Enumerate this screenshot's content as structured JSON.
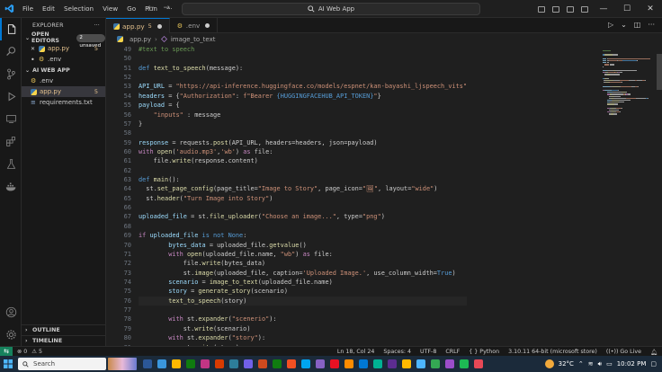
{
  "titlebar": {
    "menu": [
      "File",
      "Edit",
      "Selection",
      "View",
      "Go",
      "Run",
      "···"
    ],
    "search_text": "AI Web App",
    "back": "←",
    "forward": "→",
    "minimize": "—",
    "maximize": "☐",
    "close": "✕"
  },
  "sidebar": {
    "header": "EXPLORER",
    "open_editors_label": "OPEN EDITORS",
    "unsaved_badge": "2 unsaved",
    "open_editors": [
      {
        "name": "app.py",
        "count": "5"
      },
      {
        "name": ".env",
        "count": ""
      }
    ],
    "project_label": "AI WEB APP",
    "files": [
      {
        "name": ".env",
        "count": ""
      },
      {
        "name": "app.py",
        "count": "5"
      },
      {
        "name": "requirements.txt",
        "count": ""
      }
    ],
    "outline_label": "OUTLINE",
    "timeline_label": "TIMELINE"
  },
  "tabs": [
    {
      "name": "app.py",
      "count": "5"
    },
    {
      "name": ".env",
      "count": ""
    }
  ],
  "breadcrumb": {
    "file": "app.py",
    "symbol": "image_to_text"
  },
  "editor": {
    "line_numbers": [
      "49",
      "50",
      "51",
      "52",
      "53",
      "54",
      "55",
      "56",
      "57",
      "58",
      "59",
      "60",
      "61",
      "62",
      "63",
      "64",
      "65",
      "66",
      "67",
      "68",
      "69",
      "70",
      "71",
      "72",
      "73",
      "74",
      "75",
      "76",
      "77",
      "78",
      "79",
      "80",
      "81"
    ],
    "current_line_index": 27
  },
  "code_lines": [
    [
      [
        "#text to speech",
        "#6a9955"
      ]
    ],
    [],
    [
      [
        "def ",
        "#569cd6"
      ],
      [
        "text_to_speech",
        "#dcdcaa"
      ],
      [
        "(message):",
        "#cccccc"
      ]
    ],
    [],
    [
      [
        "API_URL",
        "#9cdcfe"
      ],
      [
        " = ",
        "#cccccc"
      ],
      [
        "\"https://api-inference.huggingface.co/models/espnet/kan-bayashi_ljspeech_vits\"",
        "#ce9178"
      ]
    ],
    [
      [
        "headers",
        "#9cdcfe"
      ],
      [
        " = {",
        "#cccccc"
      ],
      [
        "\"Authorization\"",
        "#ce9178"
      ],
      [
        ": ",
        "#cccccc"
      ],
      [
        "f\"Bearer ",
        "#ce9178"
      ],
      [
        "{HUGGINGFACEHUB_API_TOKEN}",
        "#569cd6"
      ],
      [
        "\"",
        "#ce9178"
      ],
      [
        "}",
        "#cccccc"
      ]
    ],
    [
      [
        "payload",
        "#9cdcfe"
      ],
      [
        " = {",
        "#cccccc"
      ]
    ],
    [
      [
        "    ",
        "#cccccc"
      ],
      [
        "\"inputs\"",
        "#ce9178"
      ],
      [
        " : message",
        "#cccccc"
      ]
    ],
    [
      [
        "}",
        "#cccccc"
      ]
    ],
    [],
    [
      [
        "response",
        "#9cdcfe"
      ],
      [
        " = requests.",
        "#cccccc"
      ],
      [
        "post",
        "#dcdcaa"
      ],
      [
        "(API_URL, headers=headers, json=payload)",
        "#cccccc"
      ]
    ],
    [
      [
        "with ",
        "#c586c0"
      ],
      [
        "open",
        "#dcdcaa"
      ],
      [
        "(",
        "#cccccc"
      ],
      [
        "'audio.mp3'",
        "#ce9178"
      ],
      [
        ",",
        "#cccccc"
      ],
      [
        "'wb'",
        "#ce9178"
      ],
      [
        ") ",
        "#cccccc"
      ],
      [
        "as ",
        "#c586c0"
      ],
      [
        "file:",
        "#cccccc"
      ]
    ],
    [
      [
        "    file.",
        "#cccccc"
      ],
      [
        "write",
        "#dcdcaa"
      ],
      [
        "(response.content)",
        "#cccccc"
      ]
    ],
    [],
    [
      [
        "def ",
        "#569cd6"
      ],
      [
        "main",
        "#dcdcaa"
      ],
      [
        "():",
        "#cccccc"
      ]
    ],
    [
      [
        "  st.",
        "#cccccc"
      ],
      [
        "set_page_config",
        "#dcdcaa"
      ],
      [
        "(page_title=",
        "#cccccc"
      ],
      [
        "\"Image to Story\"",
        "#ce9178"
      ],
      [
        ", page_icon=",
        "#cccccc"
      ],
      [
        "\"🖼\"",
        "#ce9178"
      ],
      [
        ", layout=",
        "#cccccc"
      ],
      [
        "\"wide\"",
        "#ce9178"
      ],
      [
        ")",
        "#cccccc"
      ]
    ],
    [
      [
        "  st.",
        "#cccccc"
      ],
      [
        "header",
        "#dcdcaa"
      ],
      [
        "(",
        "#cccccc"
      ],
      [
        "\"Turn Image into Story\"",
        "#ce9178"
      ],
      [
        ")",
        "#cccccc"
      ]
    ],
    [],
    [
      [
        "uploaded_file",
        "#9cdcfe"
      ],
      [
        " = st.",
        "#cccccc"
      ],
      [
        "file_uploader",
        "#dcdcaa"
      ],
      [
        "(",
        "#cccccc"
      ],
      [
        "\"Choose an image...\"",
        "#ce9178"
      ],
      [
        ", type=",
        "#cccccc"
      ],
      [
        "\"png\"",
        "#ce9178"
      ],
      [
        ")",
        "#cccccc"
      ]
    ],
    [],
    [
      [
        "if ",
        "#c586c0"
      ],
      [
        "uploaded_file ",
        "#9cdcfe"
      ],
      [
        "is not ",
        "#569cd6"
      ],
      [
        "None",
        "#569cd6"
      ],
      [
        ":",
        "#cccccc"
      ]
    ],
    [
      [
        "        bytes_data",
        "#9cdcfe"
      ],
      [
        " = uploaded_file.",
        "#cccccc"
      ],
      [
        "getvalue",
        "#dcdcaa"
      ],
      [
        "()",
        "#cccccc"
      ]
    ],
    [
      [
        "        with ",
        "#c586c0"
      ],
      [
        "open",
        "#dcdcaa"
      ],
      [
        "(uploaded_file.name, ",
        "#cccccc"
      ],
      [
        "\"wb\"",
        "#ce9178"
      ],
      [
        ") ",
        "#cccccc"
      ],
      [
        "as ",
        "#c586c0"
      ],
      [
        "file:",
        "#cccccc"
      ]
    ],
    [
      [
        "            file.",
        "#cccccc"
      ],
      [
        "write",
        "#dcdcaa"
      ],
      [
        "(bytes_data)",
        "#cccccc"
      ]
    ],
    [
      [
        "            st.",
        "#cccccc"
      ],
      [
        "image",
        "#dcdcaa"
      ],
      [
        "(uploaded_file, caption=",
        "#cccccc"
      ],
      [
        "'Uploaded Image.'",
        "#ce9178"
      ],
      [
        ", use_column_width=",
        "#cccccc"
      ],
      [
        "True",
        "#569cd6"
      ],
      [
        ")",
        "#cccccc"
      ]
    ],
    [
      [
        "        scenario",
        "#9cdcfe"
      ],
      [
        " = ",
        "#cccccc"
      ],
      [
        "image_to_text",
        "#dcdcaa"
      ],
      [
        "(uploaded_file.name)",
        "#cccccc"
      ]
    ],
    [
      [
        "        story",
        "#9cdcfe"
      ],
      [
        " = ",
        "#cccccc"
      ],
      [
        "generate_story",
        "#dcdcaa"
      ],
      [
        "(scenario)",
        "#cccccc"
      ]
    ],
    [
      [
        "        ",
        "#cccccc"
      ],
      [
        "text_to_speech",
        "#dcdcaa"
      ],
      [
        "(story)",
        "#cccccc"
      ]
    ],
    [],
    [
      [
        "        with ",
        "#c586c0"
      ],
      [
        "st.",
        "#cccccc"
      ],
      [
        "expander",
        "#dcdcaa"
      ],
      [
        "(",
        "#cccccc"
      ],
      [
        "\"scenerio\"",
        "#ce9178"
      ],
      [
        "):",
        "#cccccc"
      ]
    ],
    [
      [
        "            st.",
        "#cccccc"
      ],
      [
        "write",
        "#dcdcaa"
      ],
      [
        "(scenario)",
        "#cccccc"
      ]
    ],
    [
      [
        "        with ",
        "#c586c0"
      ],
      [
        "st.",
        "#cccccc"
      ],
      [
        "expander",
        "#dcdcaa"
      ],
      [
        "(",
        "#cccccc"
      ],
      [
        "\"story\"",
        "#ce9178"
      ],
      [
        "):",
        "#cccccc"
      ]
    ],
    [
      [
        "            st.",
        "#cccccc"
      ],
      [
        "write",
        "#dcdcaa"
      ],
      [
        "(story)",
        "#cccccc"
      ]
    ]
  ],
  "statusbar": {
    "errors": "⊗ 0",
    "warnings": "⚠ 5",
    "position": "Ln 18, Col 24",
    "spaces": "Spaces: 4",
    "encoding": "UTF-8",
    "eol": "CRLF",
    "language": "Python",
    "interpreter": "3.10.11 64-bit (microsoft store)",
    "golive": "Go Live"
  },
  "taskbar": {
    "search_placeholder": "Search",
    "temperature": "32°C",
    "time": "10:02 PM",
    "app_colors": [
      "#2b5797",
      "#3a96dd",
      "#ffb900",
      "#0f7b0f",
      "#c13584",
      "#d83b01",
      "#2d7d9a",
      "#7160e8",
      "#cf4a1f",
      "#107c10",
      "#f25022",
      "#00a4ef",
      "#8661c5",
      "#e81123",
      "#ff8c00",
      "#0078d4",
      "#00b294",
      "#5c2d91",
      "#ffb900",
      "#4db6ff",
      "#34a853",
      "#9b4dca",
      "#1db954",
      "#e74856"
    ]
  },
  "colors": {
    "accent": "#0078d4",
    "status_remote": "#16825d",
    "modified": "#e2c08d"
  }
}
